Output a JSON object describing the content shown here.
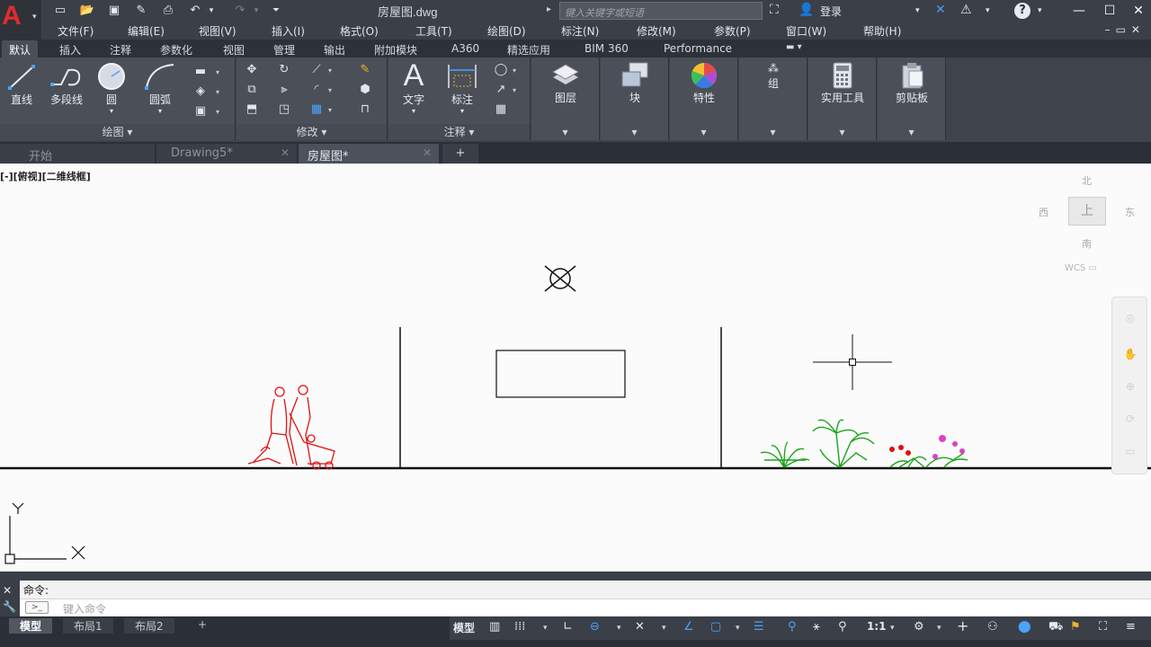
{
  "app": {
    "file_title": "房屋图.dwg",
    "search_placeholder": "键入关键字或短语",
    "login_label": "登录"
  },
  "menu": [
    "文件(F)",
    "编辑(E)",
    "视图(V)",
    "插入(I)",
    "格式(O)",
    "工具(T)",
    "绘图(D)",
    "标注(N)",
    "修改(M)",
    "参数(P)",
    "窗口(W)",
    "帮助(H)"
  ],
  "ribbon_tabs": [
    "默认",
    "插入",
    "注释",
    "参数化",
    "视图",
    "管理",
    "输出",
    "附加模块",
    "A360",
    "精选应用",
    "BIM 360",
    "Performance"
  ],
  "ribbon": {
    "draw": {
      "title": "绘图",
      "line": "直线",
      "polyline": "多段线",
      "circle": "圆",
      "arc": "圆弧"
    },
    "modify": {
      "title": "修改"
    },
    "annotation": {
      "title": "注释",
      "text": "文字",
      "dimension": "标注"
    },
    "layers": "图层",
    "block": "块",
    "properties": "特性",
    "groups": "组",
    "utilities": "实用工具",
    "clipboard": "剪贴板"
  },
  "doc_tabs": {
    "start": "开始",
    "drawing5": "Drawing5*",
    "house": "房屋图*"
  },
  "viewport_label": "[-][俯视][二维线框]",
  "viewcube": {
    "north": "北",
    "south": "南",
    "east": "东",
    "west": "西",
    "top_face": "上",
    "wcs": "WCS"
  },
  "ucs": {
    "x": "X",
    "y": "Y"
  },
  "command": {
    "history": "命令:",
    "placeholder": "键入命令"
  },
  "layout_tabs": {
    "model": "模型",
    "layout1": "布局1",
    "layout2": "布局2",
    "add": "+"
  },
  "status": {
    "model": "模型",
    "scale": "1:1"
  },
  "colors": {
    "accent": "#e22b2b",
    "canvas": "#fbfbfb",
    "people": "#e01010",
    "plants": "#1aa51a",
    "flowers": "#e040c0"
  }
}
